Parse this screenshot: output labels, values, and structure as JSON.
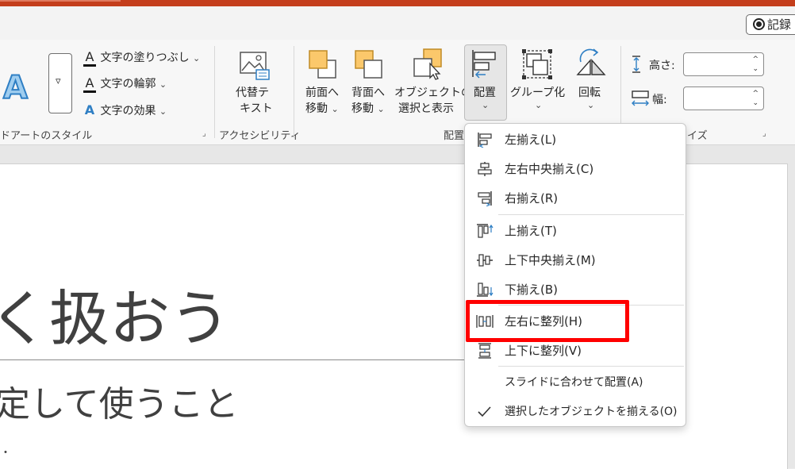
{
  "window": {
    "record_button": "記録",
    "accent_color": "#c43e1c",
    "highlight_color": "#ff0000"
  },
  "ribbon": {
    "wordart": {
      "text_fill": "文字の塗りつぶし",
      "text_outline": "文字の輪郭",
      "text_effects": "文字の効果",
      "group_label": "ドアートのスタイル"
    },
    "accessibility": {
      "alt_text_line1": "代替テ",
      "alt_text_line2": "キスト",
      "group_label": "アクセシビリティ"
    },
    "arrange": {
      "bring_forward_line1": "前面へ",
      "bring_forward_line2": "移動",
      "send_backward_line1": "背面へ",
      "send_backward_line2": "移動",
      "selection_pane_line1": "オブジェクトの",
      "selection_pane_line2": "選択と表示",
      "align": "配置",
      "group": "グループ化",
      "rotate": "回転",
      "group_label": "配置"
    },
    "size": {
      "height_label": "高さ:",
      "width_label": "幅:",
      "height_value": "",
      "width_value": "",
      "group_label": "イズ"
    }
  },
  "align_menu": {
    "items": [
      {
        "label": "左揃え(L)",
        "icon": "align-left-icon"
      },
      {
        "label": "左右中央揃え(C)",
        "icon": "align-center-icon"
      },
      {
        "label": "右揃え(R)",
        "icon": "align-right-icon"
      },
      {
        "label": "上揃え(T)",
        "icon": "align-top-icon"
      },
      {
        "label": "上下中央揃え(M)",
        "icon": "align-middle-icon"
      },
      {
        "label": "下揃え(B)",
        "icon": "align-bottom-icon"
      },
      {
        "label": "左右に整列(H)",
        "icon": "distribute-horizontal-icon"
      },
      {
        "label": "上下に整列(V)",
        "icon": "distribute-vertical-icon"
      },
      {
        "label": "スライドに合わせて配置(A)",
        "icon": ""
      },
      {
        "label": "選択したオブジェクトを揃える(O)",
        "icon": "check-icon",
        "checked": true
      }
    ]
  },
  "slide": {
    "title": "く扱おう",
    "subtitle": "定して使うこと",
    "bullet": "・"
  }
}
